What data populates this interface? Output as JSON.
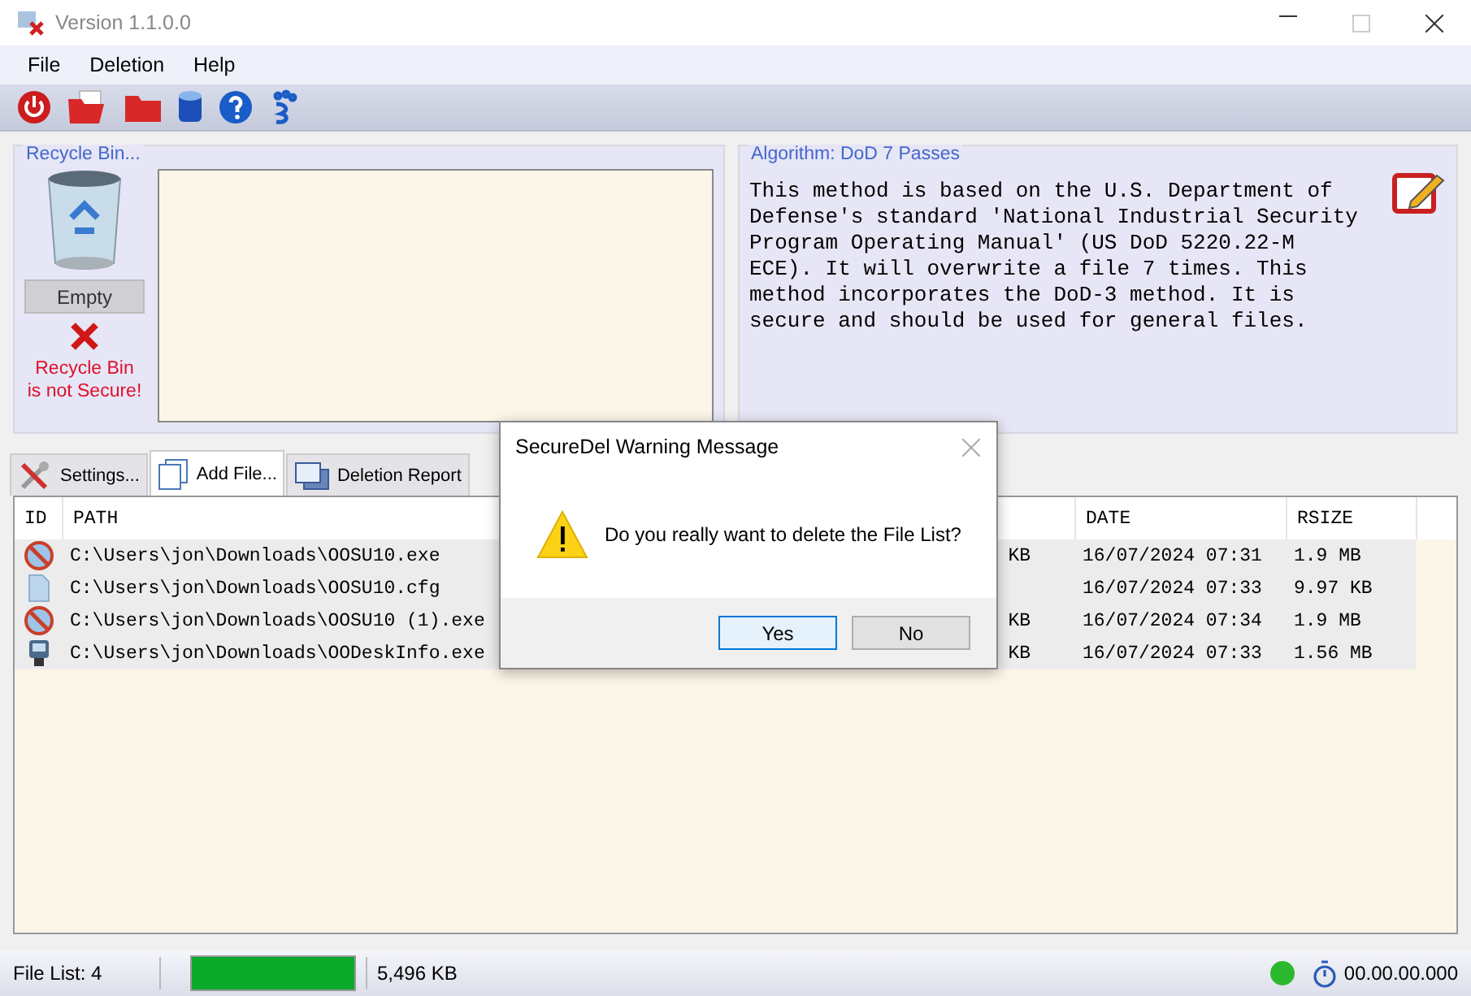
{
  "window": {
    "title": "Version 1.1.0.0"
  },
  "menu": [
    "File",
    "Deletion",
    "Help"
  ],
  "recycle_bin": {
    "legend": "Recycle Bin...",
    "button": "Empty",
    "warning": [
      "Recycle Bin",
      "is not Secure!"
    ]
  },
  "algorithm": {
    "legend": "Algorithm: DoD 7 Passes",
    "description": "This method is based on the U.S. Department of Defense's standard 'National Industrial Security Program Operating Manual' (US DoD 5220.22-M ECE). It will overwrite a file 7 times. This method incorporates the DoD-3 method. It is secure and should be used for general files."
  },
  "tabs": [
    {
      "label": "Settings...",
      "kind": "tools",
      "selected": false
    },
    {
      "label": "Add File...",
      "kind": "window",
      "selected": true
    },
    {
      "label": "Deletion Report",
      "kind": "windows",
      "selected": false
    }
  ],
  "table": {
    "columns": [
      "ID",
      "PATH",
      "DATE",
      "RSIZE"
    ],
    "rows": [
      {
        "kind": "exe",
        "path": "C:\\Users\\jon\\Downloads\\OOSU10.exe",
        "column_3": "KB",
        "date": "16/07/2024 07:31",
        "rsize": "1.9 MB"
      },
      {
        "kind": "file",
        "path": "C:\\Users\\jon\\Downloads\\OOSU10.cfg",
        "date": "16/07/2024 07:33",
        "rsize": "9.97 KB"
      },
      {
        "kind": "exe",
        "path": "C:\\Users\\jon\\Downloads\\OOSU10 (1).exe",
        "column_3": "KB",
        "date": "16/07/2024 07:34",
        "rsize": "1.9 MB"
      },
      {
        "kind": "device",
        "path": "C:\\Users\\jon\\Downloads\\OODeskInfo.exe",
        "column_3": "KB",
        "date": "16/07/2024 07:33",
        "rsize": "1.56 MB"
      }
    ]
  },
  "status_bar": {
    "file_list": "File List: 4",
    "level": 1,
    "size": "5,496 KB",
    "time": "00.00.00.000"
  },
  "dialog": {
    "title": "SecureDel Warning Message",
    "message": "Do you really want to delete the File List?",
    "buttons": [
      {
        "label": "Yes",
        "selected": true
      },
      {
        "label": "No",
        "selected": false
      }
    ]
  }
}
